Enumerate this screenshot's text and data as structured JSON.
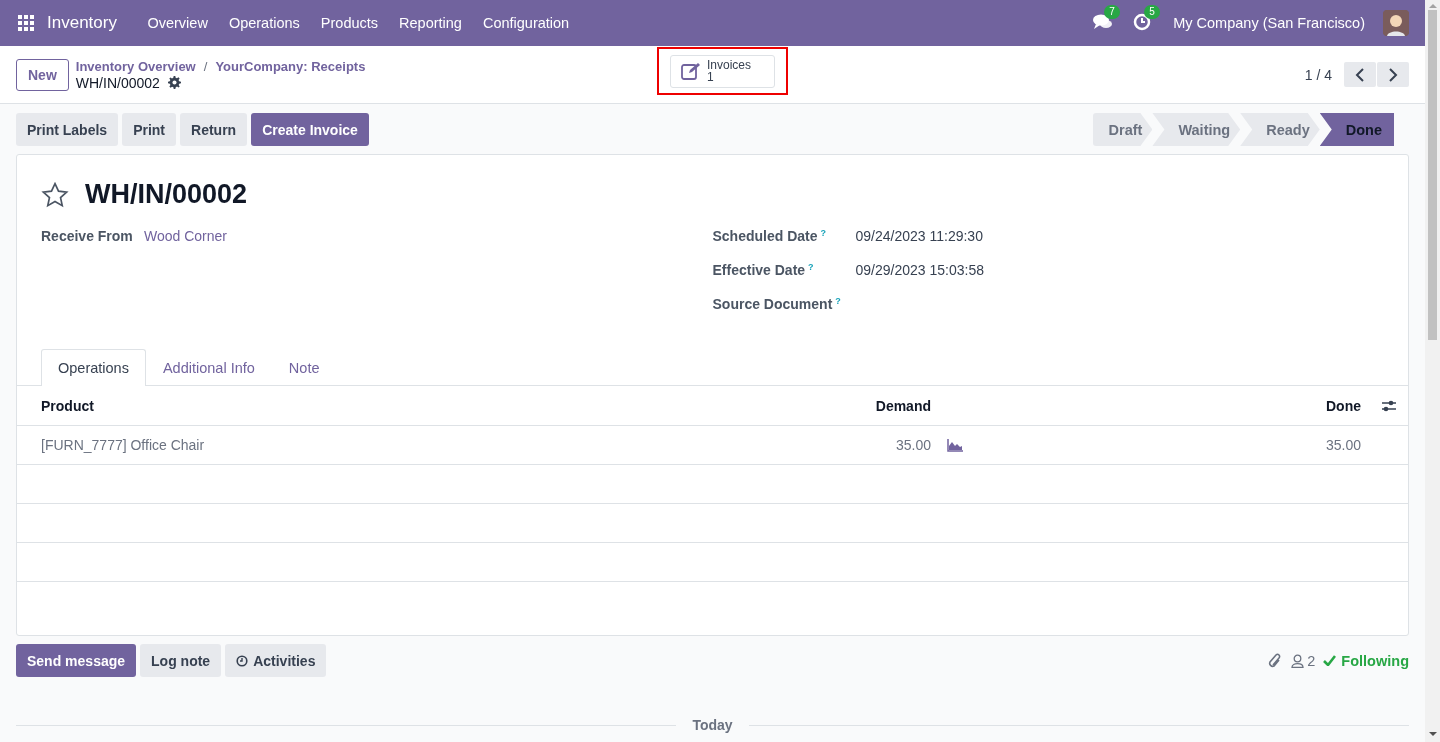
{
  "navbar": {
    "app": "Inventory",
    "menu": [
      "Overview",
      "Operations",
      "Products",
      "Reporting",
      "Configuration"
    ],
    "messages_count": "7",
    "activities_count": "5",
    "company": "My Company (San Francisco)"
  },
  "control_panel": {
    "new_button": "New",
    "breadcrumbs": [
      "Inventory Overview",
      "YourCompany: Receipts"
    ],
    "separator": "/",
    "record": "WH/IN/00002",
    "smart_button": {
      "label": "Invoices",
      "count": "1",
      "highlighted": true
    },
    "pager": "1 / 4"
  },
  "actions": [
    {
      "label": "Print Labels",
      "primary": false
    },
    {
      "label": "Print",
      "primary": false
    },
    {
      "label": "Return",
      "primary": false
    },
    {
      "label": "Create Invoice",
      "primary": true
    }
  ],
  "statusbar": [
    {
      "label": "Draft",
      "selected": false
    },
    {
      "label": "Waiting",
      "selected": false
    },
    {
      "label": "Ready",
      "selected": false
    },
    {
      "label": "Done",
      "selected": true
    }
  ],
  "form": {
    "starred": false,
    "title": "WH/IN/00002",
    "left_fields": [
      {
        "label": "Receive From",
        "value": "Wood Corner",
        "kind": "link"
      }
    ],
    "right_fields": [
      {
        "label": "Scheduled Date",
        "help": "?",
        "value": "09/24/2023 11:29:30"
      },
      {
        "label": "Effective Date",
        "help": "?",
        "value": "09/29/2023 15:03:58"
      },
      {
        "label": "Source Document",
        "help": "?"
      }
    ],
    "tabs": [
      {
        "label": "Operations",
        "selected": true
      },
      {
        "label": "Additional Info",
        "selected": false
      },
      {
        "label": "Note",
        "selected": false
      }
    ],
    "table": {
      "columns": [
        "Product",
        "Demand",
        "Done"
      ],
      "rows": [
        {
          "product": "[FURN_7777] Office Chair",
          "demand": "35.00",
          "done": "35.00"
        }
      ]
    }
  },
  "chatter": {
    "buttons": [
      {
        "label": "Send message",
        "kind": "primary"
      },
      {
        "label": "Log note",
        "kind": "plain"
      },
      {
        "label": "Activities",
        "kind": "clock"
      }
    ],
    "followers": "2",
    "follow": "Following",
    "divider": "Today"
  }
}
